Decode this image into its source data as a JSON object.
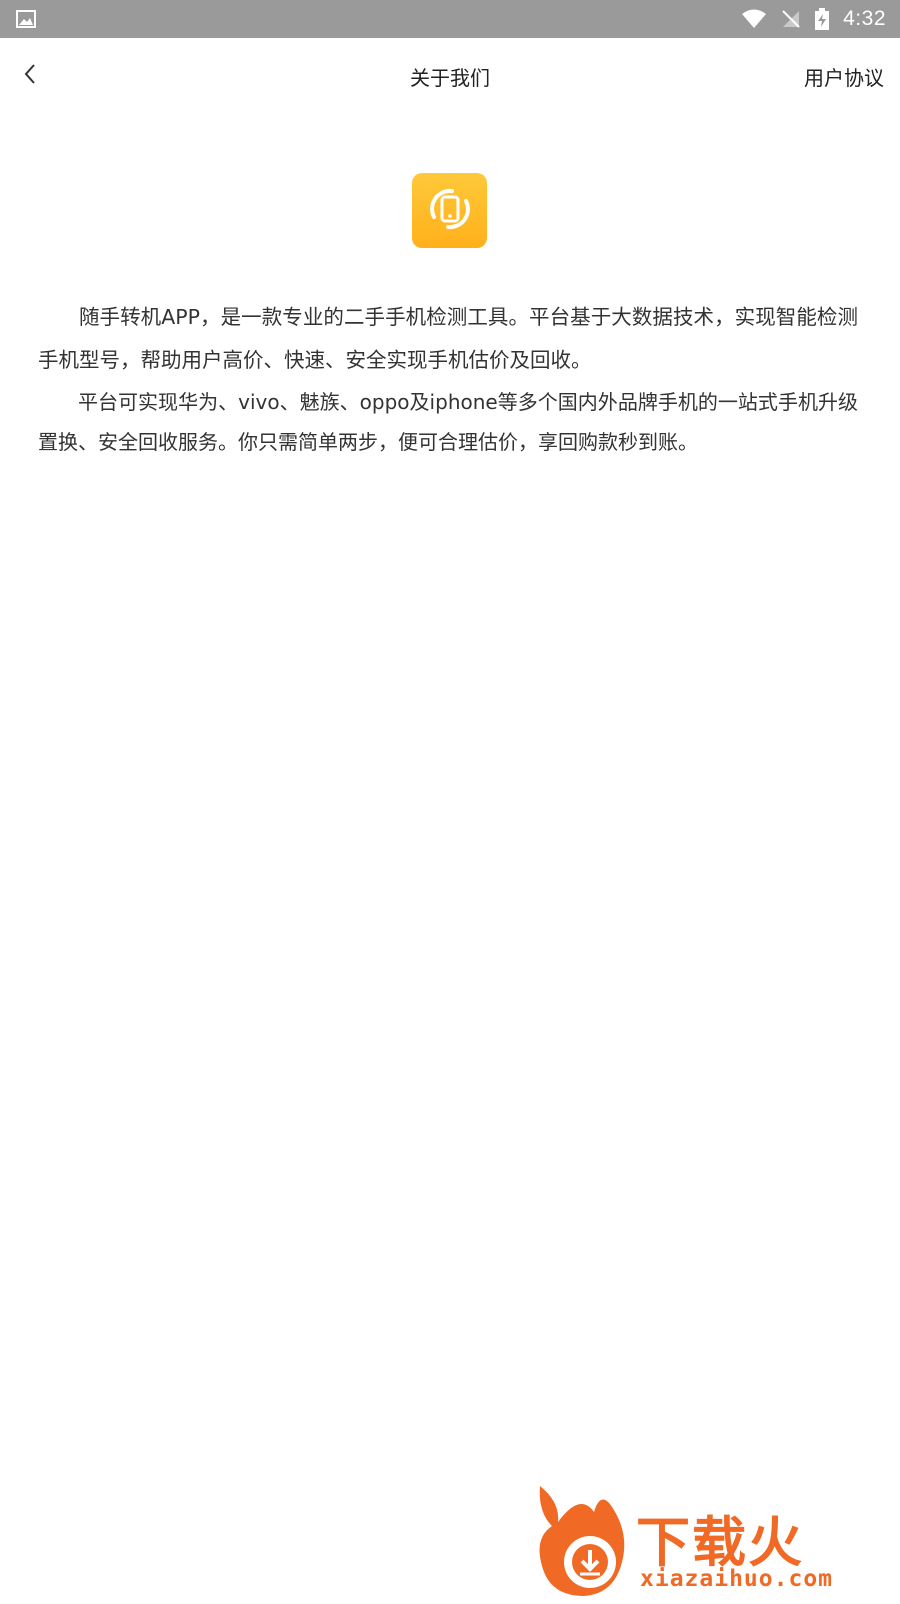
{
  "status_bar": {
    "time": "4:32",
    "icons": [
      "image-notification-icon",
      "wifi-icon",
      "no-sim-icon",
      "battery-charging-icon"
    ]
  },
  "app_bar": {
    "title": "关于我们",
    "right_link": "用户协议",
    "back_icon": "chevron-left-icon"
  },
  "logo": {
    "icon": "app-logo-phone-rotate-icon",
    "gradient": [
      "#ffc93a",
      "#ffb01a"
    ]
  },
  "content": {
    "paragraph_1": "随手转机APP，是一款专业的二手手机检测工具。平台基于大数据技术，实现智能检测手机型号，帮助用户高价、快速、安全实现手机估价及回收。",
    "paragraph_2": "平台可实现华为、vivo、魅族、oppo及iphone等多个国内外品牌手机的一站式手机升级置换、安全回收服务。你只需简单两步，便可合理估价，享回购款秒到账。"
  },
  "watermark": {
    "brand": "下载火",
    "url": "xiazaihuo.com",
    "color": "#f06a25"
  },
  "colors": {
    "status_bar": "#9a9a9a",
    "background": "#ffffff",
    "text": "#333333"
  }
}
